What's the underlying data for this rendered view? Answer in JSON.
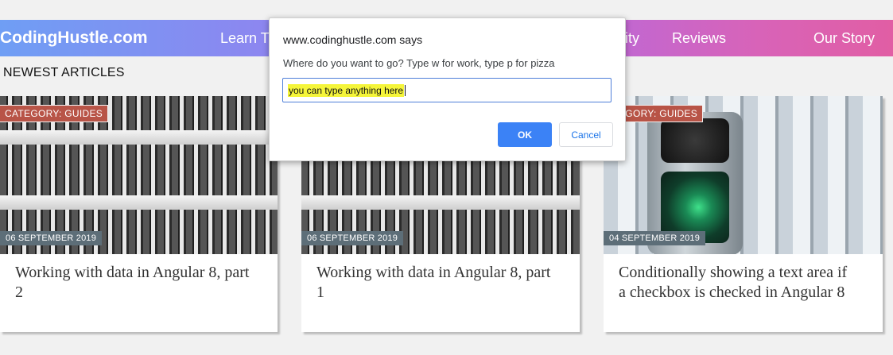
{
  "nav": {
    "brand": "CodingHustle.com",
    "items": [
      "Learn T",
      "ity",
      "Reviews",
      "Our Story"
    ]
  },
  "section_title": "NEWEST ARTICLES",
  "articles": [
    {
      "category": "CATEGORY: GUIDES",
      "date": "06 SEPTEMBER 2019",
      "title": "Working with data in Angular 8, part 2"
    },
    {
      "category": "",
      "date": "06 SEPTEMBER 2019",
      "title": "Working with data in Angular 8, part 1"
    },
    {
      "category": "EGORY: GUIDES",
      "date": "04 SEPTEMBER 2019",
      "title": "Conditionally showing a text area if a checkbox is checked in Angular 8"
    }
  ],
  "dialog": {
    "title": "www.codinghustle.com says",
    "message": "Where do you want to go? Type w for work, type p for pizza",
    "input_value": "you can type anything here",
    "ok_label": "OK",
    "cancel_label": "Cancel"
  },
  "colors": {
    "accent": "#3b82f6",
    "category_badge": "#b85447",
    "date_badge": "#5d6e78"
  }
}
